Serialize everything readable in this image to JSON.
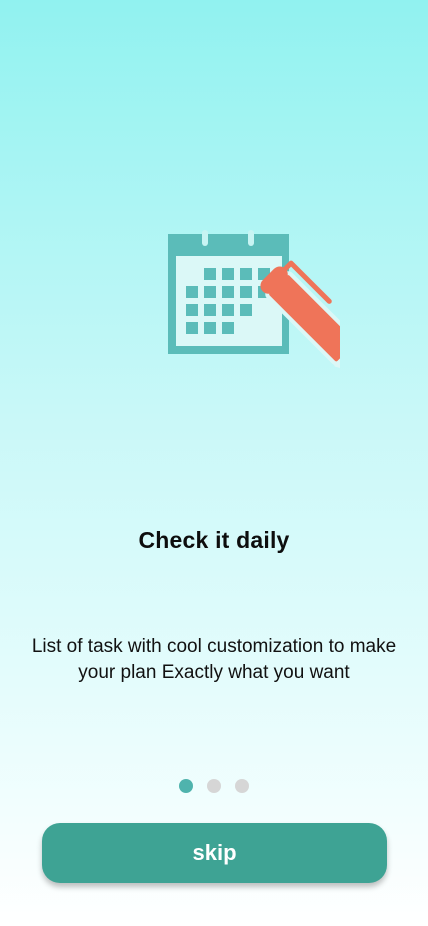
{
  "onboarding": {
    "illustration_icon": "calendar-with-pencil-icon",
    "title": "Check it daily",
    "description": "List of task with cool customization to make your plan Exactly what you want",
    "pager": {
      "total_pages": 3,
      "active_index": 0
    },
    "skip_label": "skip"
  },
  "colors": {
    "background_top": "#91f2f0",
    "background_bottom": "#ffffff",
    "calendar": "#5bbcb9",
    "pencil": "#ef7459",
    "dot_active": "#4fb3ad",
    "dot_inactive": "#d6d6d6",
    "button": "#3ea394"
  }
}
